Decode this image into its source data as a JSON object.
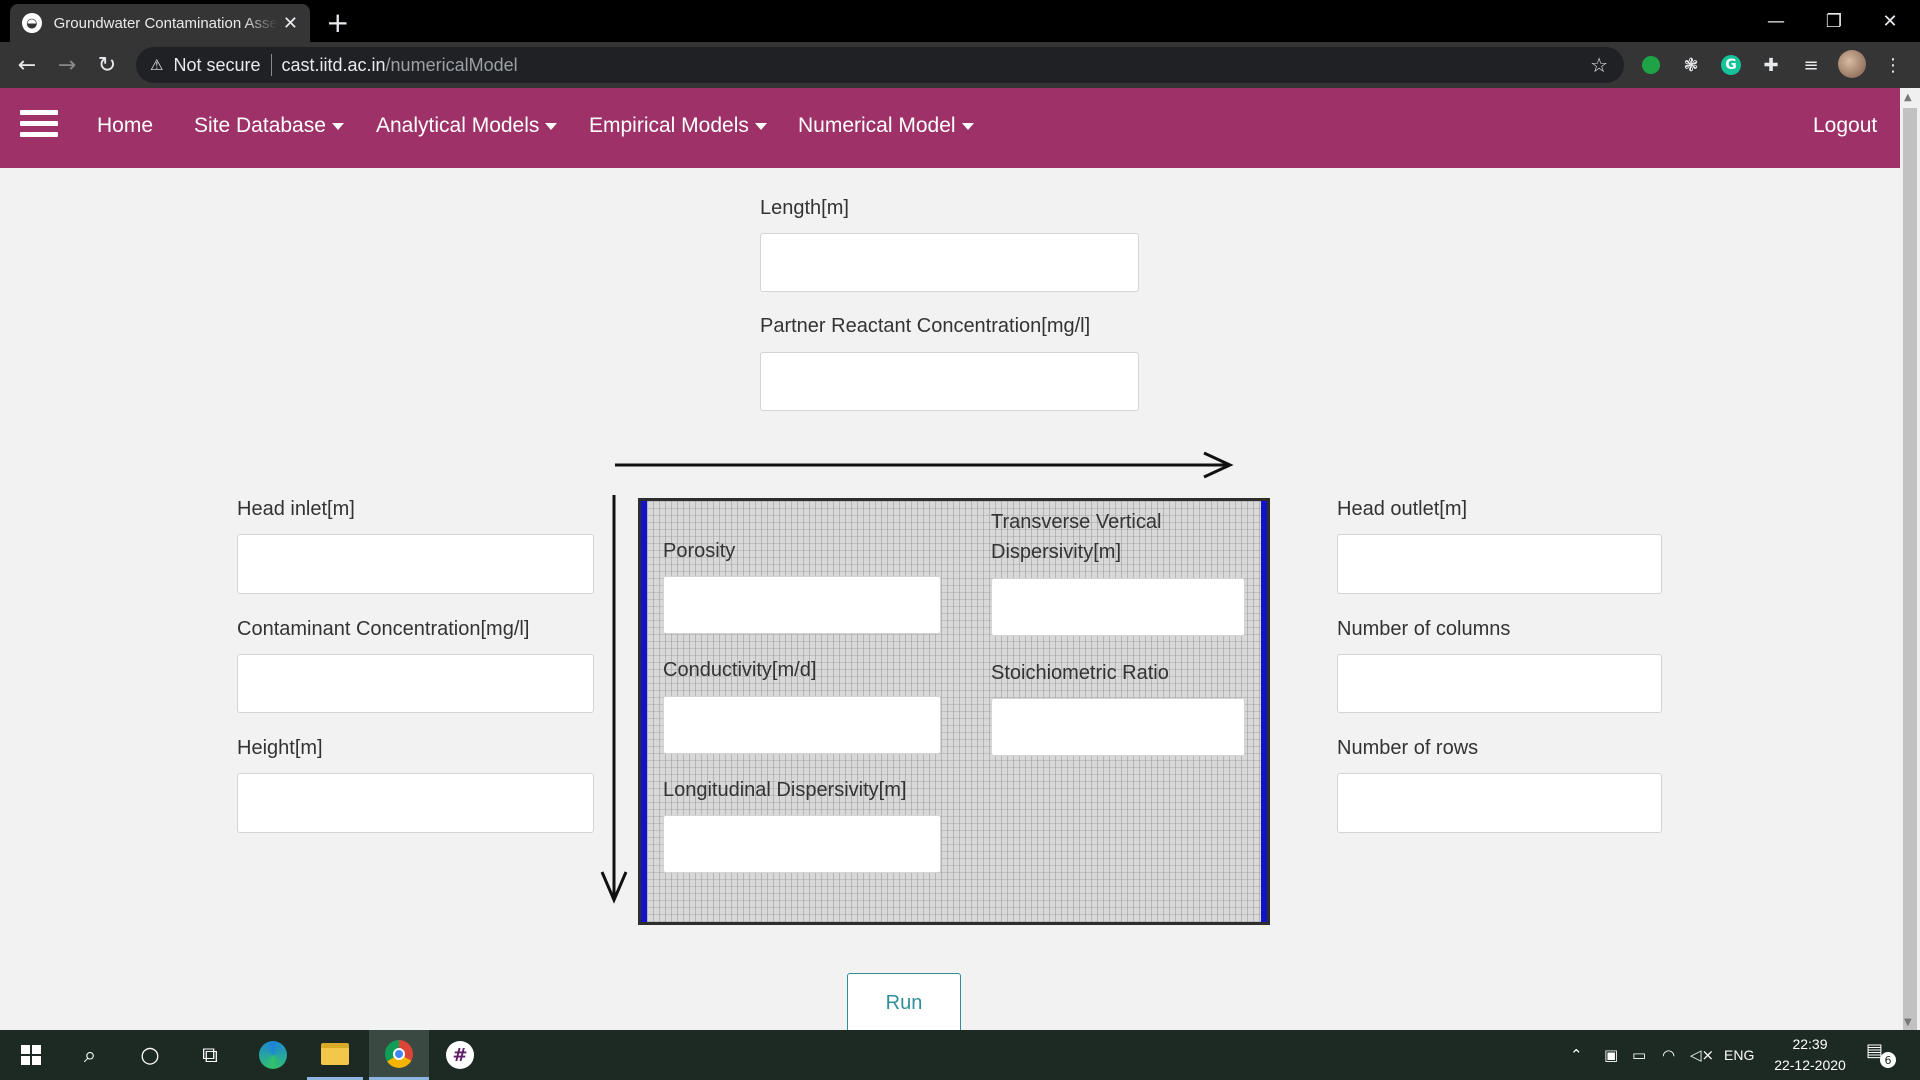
{
  "browser": {
    "tab_title": "Groundwater Contamination Assessment",
    "tab_close": "✕",
    "new_tab": "+",
    "window_controls": {
      "minimize": "—",
      "restore": "❐",
      "close": "✕"
    },
    "nav": {
      "back": "←",
      "forward": "→",
      "reload": "↻"
    },
    "security_icon": "⚠",
    "security_text": "Not secure",
    "url_host": "cast.iitd.ac.in",
    "url_path": "/numericalModel",
    "bookmark_icon": "☆",
    "extensions": [
      "green-dot-icon",
      "gear-icon",
      "grammarly-icon",
      "puzzle-icon",
      "media-icon"
    ],
    "ext_glyphs": {
      "gear": "❃",
      "grammarly": "G",
      "puzzle": "✚",
      "media": "≡",
      "menu": "⋮"
    }
  },
  "site_nav": {
    "items": [
      {
        "label": "Home",
        "dropdown": false
      },
      {
        "label": "Site Database",
        "dropdown": true
      },
      {
        "label": "Analytical Models",
        "dropdown": true
      },
      {
        "label": "Empirical Models",
        "dropdown": true
      },
      {
        "label": "Numerical Model",
        "dropdown": true
      }
    ],
    "logout": "Logout",
    "accent_color": "#9e3268"
  },
  "form": {
    "top": {
      "length_label": "Length[m]",
      "partner_label": "Partner Reactant Concentration[mg/l]"
    },
    "left": {
      "head_inlet_label": "Head inlet[m]",
      "contaminant_label": "Contaminant Concentration[mg/l]",
      "height_label": "Height[m]"
    },
    "right": {
      "head_outlet_label": "Head outlet[m]",
      "columns_label": "Number of columns",
      "rows_label": "Number of rows"
    },
    "diagram": {
      "porosity_label": "Porosity",
      "tvd_label_1": "Transverse Vertical",
      "tvd_label_2": "Dispersivity[m]",
      "conductivity_label": "Conductivity[m/d]",
      "stoich_label": "Stoichiometric Ratio",
      "longitudinal_label": "Longitudinal Dispersivity[m]",
      "boundary_color": "#1212c8"
    },
    "run_label": "Run",
    "run_color": "#2f8f9a"
  },
  "taskbar": {
    "search_icon": "⌕",
    "cortana_icon": "○",
    "taskview_icon": "⧉",
    "tray_chevron": "⌃",
    "language": "ENG",
    "time": "22:39",
    "date": "22-12-2020",
    "notification_icon": "▤",
    "notification_count": "6"
  }
}
